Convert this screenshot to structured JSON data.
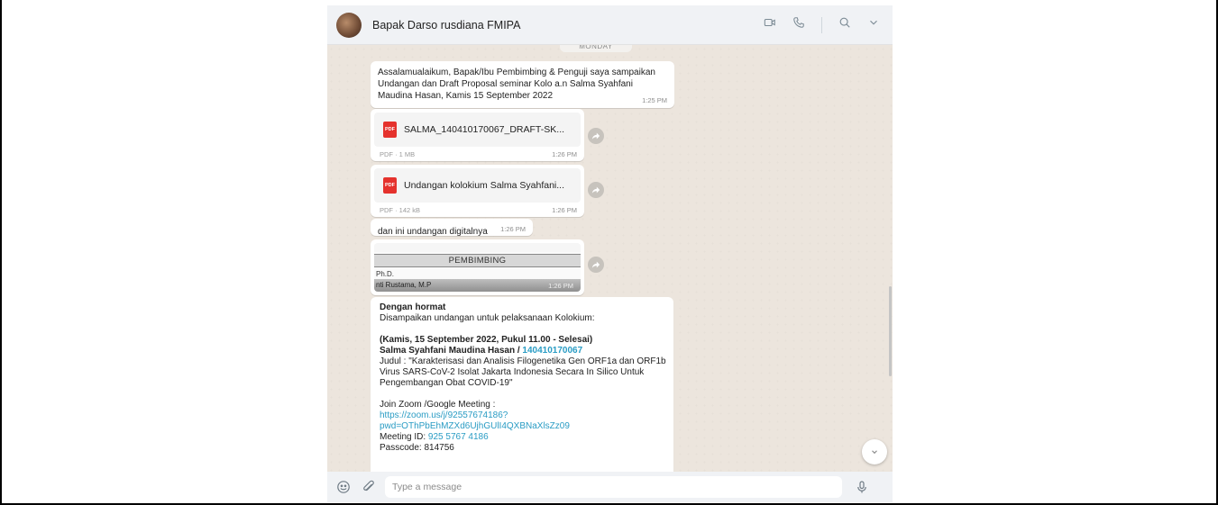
{
  "header": {
    "contact_name": "Bapak Darso rusdiana FMIPA",
    "icons": [
      "video-call-icon",
      "voice-call-icon",
      "search-icon",
      "chevron-down-icon"
    ]
  },
  "chat": {
    "day_label": "MONDAY",
    "messages": [
      {
        "type": "text",
        "lines": [
          "Assalamualaikum, Bapak/Ibu Pembimbing & Penguji saya sampaikan",
          "Undangan  dan Draft Proposal seminar Kolo a.n Salma Syahfani",
          "Maudina Hasan,  Kamis 15 September 2022"
        ],
        "time": "1:25 PM"
      },
      {
        "type": "document",
        "icon": "PDF",
        "name": "SALMA_140410170067_DRAFT-SK...",
        "meta": "PDF · 1 MB",
        "time": "1:26 PM"
      },
      {
        "type": "document",
        "icon": "PDF",
        "name": "Undangan kolokium Salma Syahfani...",
        "meta": "PDF · 142 kB",
        "time": "1:26 PM"
      },
      {
        "type": "text",
        "text": "dan ini undangan  digitalnya",
        "time": "1:26 PM"
      },
      {
        "type": "image",
        "title": "PEMBIMBING",
        "line1": "Ph.D.",
        "line2": "nti Rustama, M.P",
        "time": "1:26 PM"
      },
      {
        "type": "rich",
        "lines": {
          "greeting": "Dengan hormat",
          "intro": "Disampaikan undangan untuk pelaksanaan Kolokium:",
          "when": "(Kamis, 15 September 2022, Pukul 11.00 - Selesai)",
          "student_name": "Salma Syahfani Maudina Hasan / ",
          "student_id": "140410170067",
          "title1": "Judul : \"Karakterisasi dan Analisis Filogenetika Gen ORF1a dan ORF1b",
          "title2": "Virus SARS-CoV-2 Isolat Jakarta Indonesia Secara In Silico Untuk",
          "title3": "Pengembangan Obat COVID-19\"",
          "join": "Join Zoom /Google Meeting :",
          "link1": "https://zoom.us/j/92557674186?",
          "link2": "pwd=OThPbEhMZXd6UjhGUlI4QXBNaXlsZz09",
          "meeting_label": "Meeting ID: ",
          "meeting_id": "925 5767 4186",
          "passcode": "Passcode: 814756"
        }
      }
    ]
  },
  "composer": {
    "placeholder": "Type a message"
  }
}
